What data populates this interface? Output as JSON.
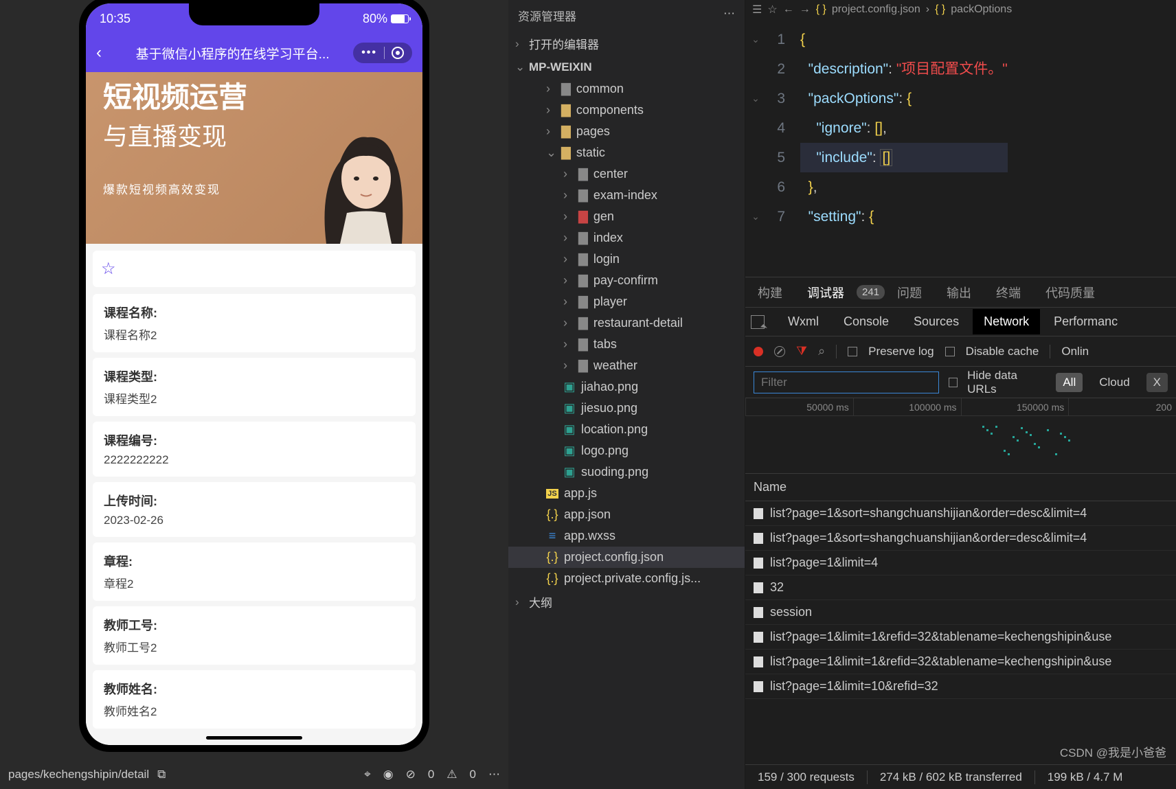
{
  "simulator": {
    "time": "10:35",
    "battery": "80%",
    "app_title": "基于微信小程序的在线学习平台...",
    "hero_title": "短视频运营",
    "hero_sub": "与直播变现",
    "hero_caption": "爆款短视频高效变现",
    "details": [
      {
        "label": "课程名称:",
        "value": "课程名称2"
      },
      {
        "label": "课程类型:",
        "value": "课程类型2"
      },
      {
        "label": "课程编号:",
        "value": "2222222222"
      },
      {
        "label": "上传时间:",
        "value": "2023-02-26"
      },
      {
        "label": "章程:",
        "value": "章程2"
      },
      {
        "label": "教师工号:",
        "value": "教师工号2"
      },
      {
        "label": "教师姓名:",
        "value": "教师姓名2"
      }
    ],
    "footer_path": "pages/kechengshipin/detail",
    "footer_zero1": "0",
    "footer_zero2": "0"
  },
  "explorer": {
    "title": "资源管理器",
    "open_editors": "打开的编辑器",
    "project": "MP-WEIXIN",
    "folders": [
      {
        "name": "common",
        "type": "folder"
      },
      {
        "name": "components",
        "type": "folder-yellow"
      },
      {
        "name": "pages",
        "type": "folder-yellow"
      },
      {
        "name": "static",
        "type": "folder-yellow",
        "open": true,
        "children": [
          {
            "name": "center",
            "type": "folder"
          },
          {
            "name": "exam-index",
            "type": "folder"
          },
          {
            "name": "gen",
            "type": "folder-red"
          },
          {
            "name": "index",
            "type": "folder"
          },
          {
            "name": "login",
            "type": "folder"
          },
          {
            "name": "pay-confirm",
            "type": "folder"
          },
          {
            "name": "player",
            "type": "folder"
          },
          {
            "name": "restaurant-detail",
            "type": "folder"
          },
          {
            "name": "tabs",
            "type": "folder"
          },
          {
            "name": "weather",
            "type": "folder"
          },
          {
            "name": "jiahao.png",
            "type": "img"
          },
          {
            "name": "jiesuo.png",
            "type": "img"
          },
          {
            "name": "location.png",
            "type": "img"
          },
          {
            "name": "logo.png",
            "type": "img"
          },
          {
            "name": "suoding.png",
            "type": "img"
          }
        ]
      },
      {
        "name": "app.js",
        "type": "js"
      },
      {
        "name": "app.json",
        "type": "json"
      },
      {
        "name": "app.wxss",
        "type": "wxss"
      },
      {
        "name": "project.config.json",
        "type": "json",
        "selected": true
      },
      {
        "name": "project.private.config.js...",
        "type": "json"
      }
    ],
    "outline": "大纲"
  },
  "breadcrumb": {
    "file": "project.config.json",
    "part": "packOptions"
  },
  "code": {
    "lines": [
      "1",
      "2",
      "3",
      "4",
      "5",
      "6",
      "7"
    ],
    "l1": "{",
    "l2_key": "\"description\"",
    "l2_val": "\"项目配置文件。\"",
    "l3_key": "\"packOptions\"",
    "l4_key": "\"ignore\"",
    "l5_key": "\"include\"",
    "l7_key": "\"setting\""
  },
  "devtools": {
    "tabs": [
      "构建",
      "调试器",
      "问题",
      "输出",
      "终端",
      "代码质量"
    ],
    "badge": "241",
    "subtabs": [
      "Wxml",
      "Console",
      "Sources",
      "Network",
      "Performanc"
    ],
    "preserve": "Preserve log",
    "disable": "Disable cache",
    "online": "Onlin",
    "filter_ph": "Filter",
    "hide_urls": "Hide data URLs",
    "pills": [
      "All",
      "Cloud",
      "X"
    ],
    "ticks": [
      "50000 ms",
      "100000 ms",
      "150000 ms",
      "200"
    ],
    "name_header": "Name",
    "requests": [
      "list?page=1&sort=shangchuanshijian&order=desc&limit=4",
      "list?page=1&sort=shangchuanshijian&order=desc&limit=4",
      "list?page=1&limit=4",
      "32",
      "session",
      "list?page=1&limit=1&refid=32&tablename=kechengshipin&use",
      "list?page=1&limit=1&refid=32&tablename=kechengshipin&use",
      "list?page=1&limit=10&refid=32"
    ],
    "status": {
      "requests": "159 / 300 requests",
      "transferred": "274 kB / 602 kB transferred",
      "resources": "199 kB / 4.7 M"
    }
  },
  "watermark": "CSDN @我是小爸爸"
}
